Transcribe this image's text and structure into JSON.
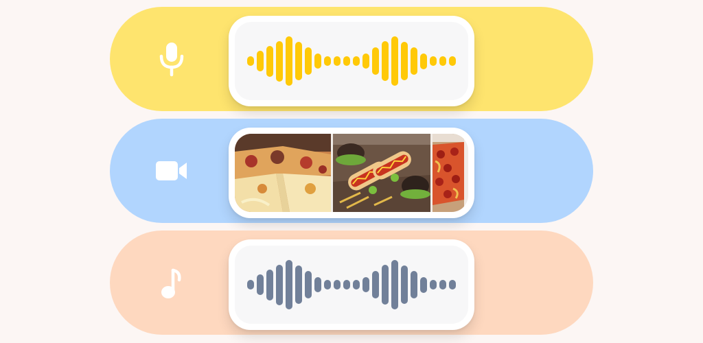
{
  "colors": {
    "page_bg": "#fcf6f4",
    "audio_row_bg": "#fee46e",
    "video_row_bg": "#b1d5fe",
    "music_row_bg": "#fed8bf",
    "icon_color": "#ffffff",
    "audio_wave_color": "#ffc908",
    "music_wave_color": "#718099"
  },
  "rows": [
    {
      "id": "audio",
      "icon": "microphone-icon",
      "content": "waveform"
    },
    {
      "id": "video",
      "icon": "video-camera-icon",
      "content": "image-thumbnails"
    },
    {
      "id": "music",
      "icon": "music-note-icon",
      "content": "waveform"
    }
  ],
  "waveform_levels": [
    0.2,
    0.42,
    0.62,
    0.82,
    1.0,
    0.78,
    0.55,
    0.3,
    0.2,
    0.2,
    0.2,
    0.2,
    0.3,
    0.55,
    0.8,
    1.0,
    0.78,
    0.55,
    0.32,
    0.2,
    0.2,
    0.2
  ],
  "thumbnails": [
    {
      "subject": "pizza-slices"
    },
    {
      "subject": "hot-dogs-and-burgers"
    },
    {
      "subject": "pepperoni-pizza"
    }
  ]
}
